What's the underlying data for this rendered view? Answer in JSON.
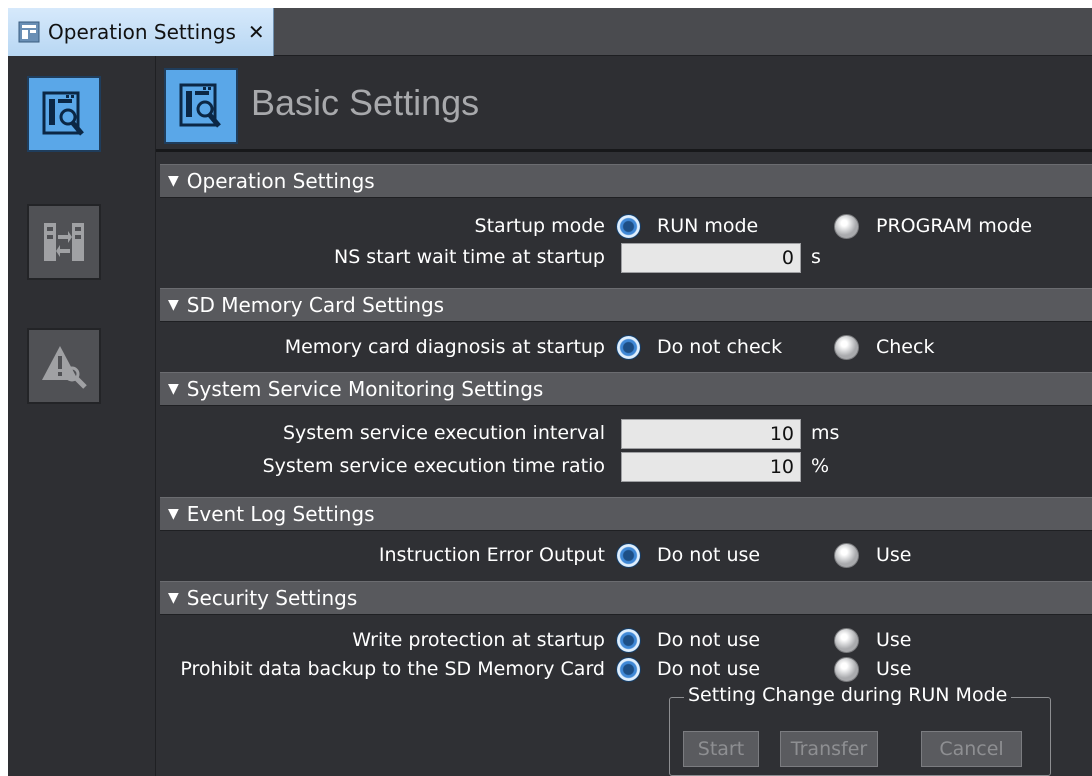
{
  "tab": {
    "label": "Operation Settings",
    "close": "✕"
  },
  "header": {
    "title": "Basic Settings"
  },
  "sections": {
    "operation": {
      "title": "Operation Settings",
      "startup_mode_label": "Startup mode",
      "startup_mode_options": [
        "RUN mode",
        "PROGRAM mode"
      ],
      "startup_mode_selected": "RUN mode",
      "ns_wait_label": "NS start wait time at startup",
      "ns_wait_value": "0",
      "ns_wait_unit": "s"
    },
    "sd_card": {
      "title": "SD Memory Card Settings",
      "diag_label": "Memory card diagnosis at startup",
      "diag_options": [
        "Do not check",
        "Check"
      ],
      "diag_selected": "Do not check"
    },
    "service": {
      "title": "System Service Monitoring Settings",
      "interval_label": "System service execution interval",
      "interval_value": "10",
      "interval_unit": "ms",
      "ratio_label": "System service execution time ratio",
      "ratio_value": "10",
      "ratio_unit": "%"
    },
    "event_log": {
      "title": "Event Log Settings",
      "error_label": "Instruction Error Output",
      "error_options": [
        "Do not use",
        "Use"
      ],
      "error_selected": "Do not use"
    },
    "security": {
      "title": "Security Settings",
      "write_label": "Write protection at startup",
      "write_options": [
        "Do not use",
        "Use"
      ],
      "write_selected": "Do not use",
      "backup_label": "Prohibit data backup to the SD Memory Card",
      "backup_options": [
        "Do not use",
        "Use"
      ],
      "backup_selected": "Do not use"
    }
  },
  "run_mode_group": {
    "title": "Setting Change during RUN Mode",
    "buttons": [
      "Start",
      "Transfer",
      "Cancel"
    ]
  },
  "colors": {
    "accent": "#5aa7e8",
    "background": "#2f3034",
    "section_header": "#58595d"
  },
  "icons": [
    "settings-page-icon",
    "io-map-icon",
    "warning-wrench-icon"
  ]
}
